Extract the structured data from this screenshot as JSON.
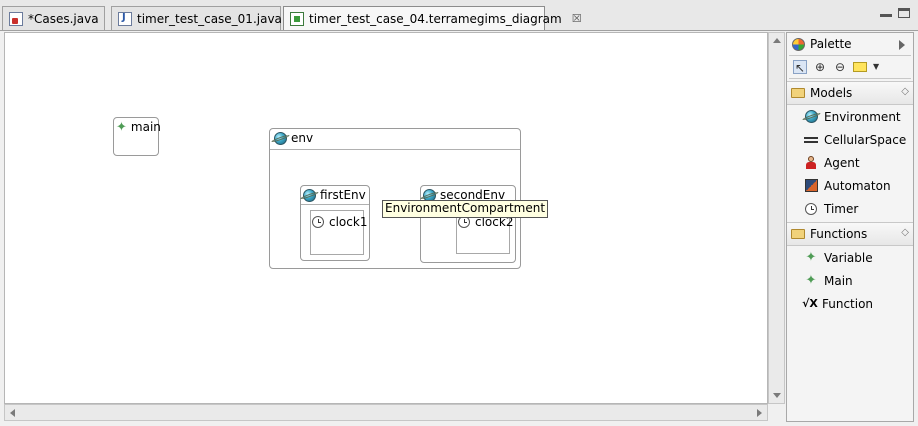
{
  "tabs": [
    {
      "label": "*Cases.java",
      "icon": "java-file-icon",
      "active": false
    },
    {
      "label": "timer_test_case_01.java",
      "icon": "java-file-icon",
      "active": false
    },
    {
      "label": "timer_test_case_04.terramegims_diagram",
      "icon": "diagram-file-icon",
      "active": true,
      "close": "☒"
    }
  ],
  "diagram": {
    "main": {
      "label": "main"
    },
    "env": {
      "label": "env"
    },
    "firstEnv": {
      "label": "firstEnv",
      "clock": "clock1"
    },
    "secondEnv": {
      "label": "secondEnv",
      "clock": "clock2"
    },
    "tooltip": "EnvironmentCompartment"
  },
  "palette": {
    "title": "Palette",
    "drawers": [
      {
        "label": "Models",
        "items": [
          {
            "label": "Environment",
            "icon": "globe-icon"
          },
          {
            "label": "CellularSpace",
            "icon": "cellular-space-icon"
          },
          {
            "label": "Agent",
            "icon": "agent-icon"
          },
          {
            "label": "Automaton",
            "icon": "automaton-icon"
          },
          {
            "label": "Timer",
            "icon": "clock-icon"
          }
        ]
      },
      {
        "label": "Functions",
        "items": [
          {
            "label": "Variable",
            "icon": "star-icon"
          },
          {
            "label": "Main",
            "icon": "star-icon"
          },
          {
            "label": "Function",
            "icon": "sqrt-x-icon",
            "glyph": "√X"
          }
        ]
      }
    ]
  },
  "colors": {
    "accent_green": "#4f9c56",
    "tooltip_bg": "#ffffe1",
    "canvas_bg": "#ffffff"
  }
}
